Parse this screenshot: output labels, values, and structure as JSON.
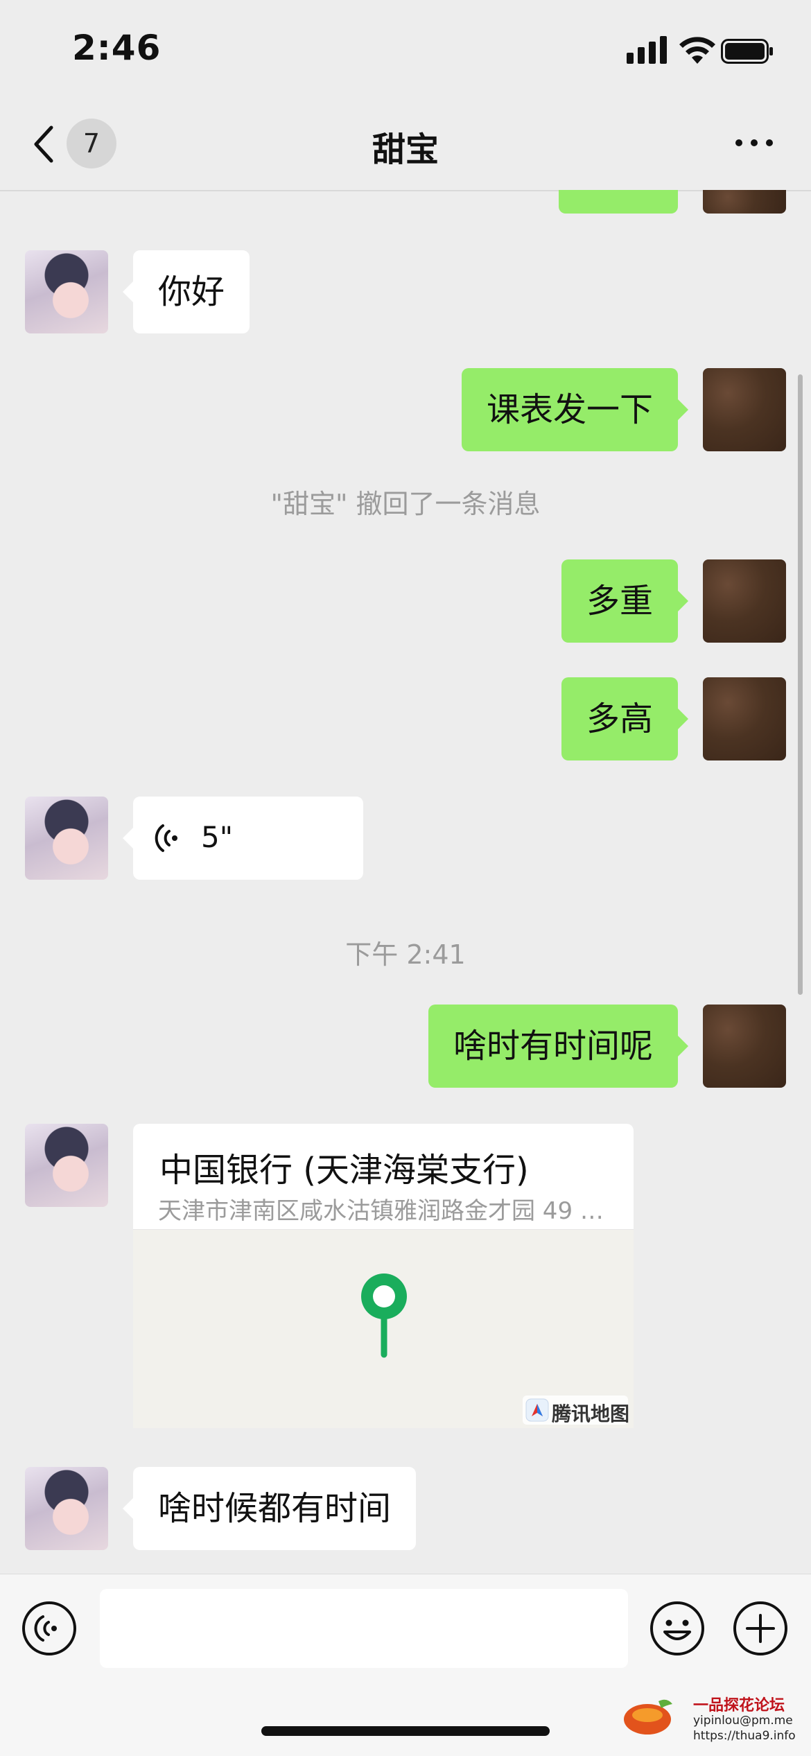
{
  "status_bar": {
    "time": "2:46"
  },
  "nav": {
    "unread_count": "7",
    "title": "甜宝"
  },
  "messages": [
    {
      "from": "other",
      "text": "你好"
    },
    {
      "from": "me",
      "text": "课表发一下"
    },
    {
      "from": "system",
      "text": "\"甜宝\" 撤回了一条消息"
    },
    {
      "from": "me",
      "text": "多重"
    },
    {
      "from": "me",
      "text": "多高"
    },
    {
      "from": "other",
      "type": "voice",
      "duration": "5\""
    },
    {
      "from": "system",
      "text": "下午 2:41"
    },
    {
      "from": "me",
      "text": "啥时有时间呢"
    },
    {
      "from": "other",
      "type": "location",
      "title": "中国银行 (天津海棠支行)",
      "address": "天津市津南区咸水沽镇雅润路金才园 49 …",
      "provider": "腾讯地图"
    },
    {
      "from": "other",
      "text": "啥时候都有时间"
    }
  ],
  "input": {
    "placeholder": ""
  },
  "colors": {
    "my_bubble": "#95ec69",
    "their_bubble": "#ffffff",
    "background": "#ededed",
    "map_pin": "#1aad5c"
  },
  "watermark": {
    "name": "一品探花论坛",
    "email": "yipinlou@pm.me",
    "url": "https://thua9.info"
  }
}
